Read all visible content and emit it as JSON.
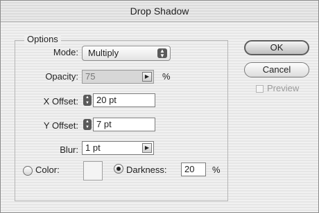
{
  "window": {
    "title": "Drop Shadow"
  },
  "options": {
    "group_label": "Options",
    "mode": {
      "label": "Mode:",
      "value": "Multiply"
    },
    "opacity": {
      "label": "Opacity:",
      "value": "75",
      "unit": "%"
    },
    "x_offset": {
      "label": "X Offset:",
      "value": "20 pt"
    },
    "y_offset": {
      "label": "Y Offset:",
      "value": "7 pt"
    },
    "blur": {
      "label": "Blur:",
      "value": "1 pt"
    },
    "color": {
      "label": "Color:",
      "selected": false
    },
    "darkness": {
      "label": "Darkness:",
      "value": "20",
      "unit": "%",
      "selected": true
    }
  },
  "buttons": {
    "ok": "OK",
    "cancel": "Cancel"
  },
  "preview": {
    "label": "Preview",
    "checked": false,
    "enabled": false
  }
}
